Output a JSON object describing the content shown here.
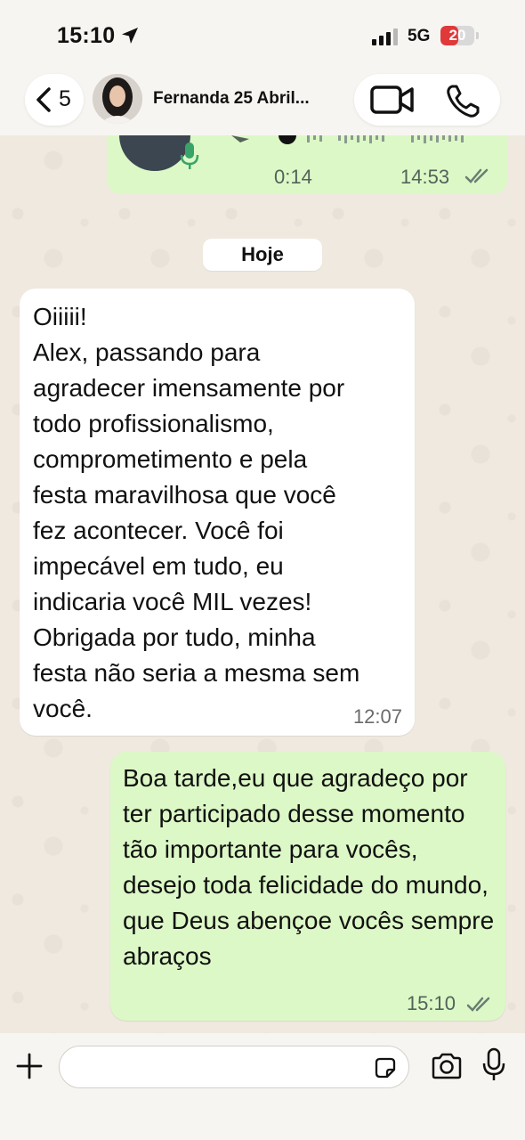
{
  "status_bar": {
    "time": "15:10",
    "network": "5G",
    "battery": "20",
    "battery_fraction": 0.2
  },
  "header": {
    "back_count": "5",
    "contact_name": "Fernanda 25 Abril..."
  },
  "audio_message": {
    "duration": "0:14",
    "time": "14:53",
    "status": "read"
  },
  "date_separator": "Hoje",
  "incoming_message": {
    "text": "Oiiiii!\nAlex, passando para\nagradecer imensamente por\ntodo profissionalismo,\ncomprometimento e pela\nfesta maravilhosa que você\nfez acontecer. Você foi\nimpecável em tudo, eu\nindicaria você MIL vezes!\nObrigada por tudo, minha\nfesta não seria a mesma sem\nvocê.",
    "time": "12:07"
  },
  "outgoing_message": {
    "text": "Boa tarde,eu que agradeço por ter participado desse momento tão importante para vocês, desejo toda felicidade do mundo, que Deus abençoe vocês sempre abraços",
    "time": "15:10",
    "status": "read"
  },
  "composer": {
    "placeholder": ""
  },
  "colors": {
    "outgoing_bubble": "#dcf8c6",
    "incoming_bubble": "#ffffff",
    "read_ticks": "#6b7d73",
    "battery_low": "#e0393a"
  }
}
